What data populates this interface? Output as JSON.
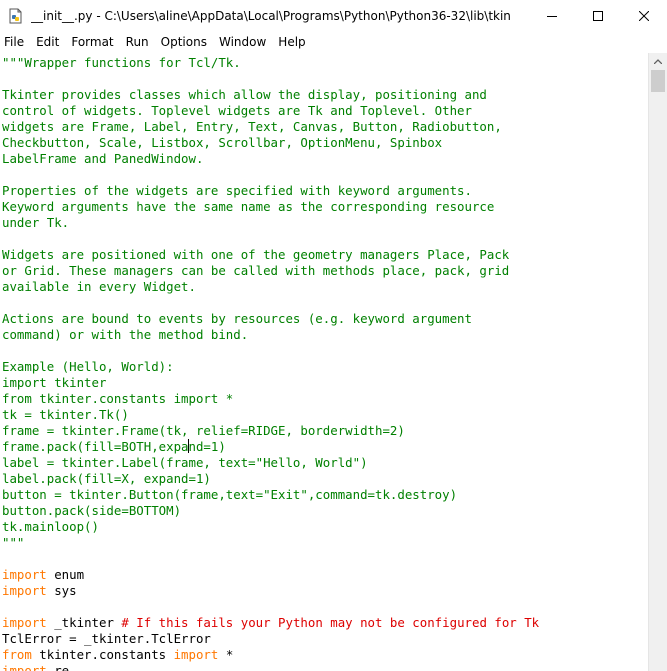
{
  "window": {
    "title": "__init__.py - C:\\Users\\aline\\AppData\\Local\\Programs\\Python\\Python36-32\\lib\\tkinter\\__init__....",
    "app_icon": "python-file-icon",
    "controls": {
      "minimize_icon": "minimize-icon",
      "maximize_icon": "maximize-icon",
      "close_icon": "close-icon"
    }
  },
  "menubar": {
    "items": [
      "File",
      "Edit",
      "Format",
      "Run",
      "Options",
      "Window",
      "Help"
    ]
  },
  "colors": {
    "string": "#008000",
    "keyword": "#ff7700",
    "comment": "#dd0000",
    "default": "#000000"
  },
  "editor": {
    "lines": [
      [
        {
          "t": "\"\"\"Wrapper functions for Tcl/Tk.",
          "c": "str"
        }
      ],
      [
        {
          "t": "",
          "c": "str"
        }
      ],
      [
        {
          "t": "Tkinter provides classes which allow the display, positioning and",
          "c": "str"
        }
      ],
      [
        {
          "t": "control of widgets. Toplevel widgets are Tk and Toplevel. Other",
          "c": "str"
        }
      ],
      [
        {
          "t": "widgets are Frame, Label, Entry, Text, Canvas, Button, Radiobutton,",
          "c": "str"
        }
      ],
      [
        {
          "t": "Checkbutton, Scale, Listbox, Scrollbar, OptionMenu, Spinbox",
          "c": "str"
        }
      ],
      [
        {
          "t": "LabelFrame and PanedWindow.",
          "c": "str"
        }
      ],
      [
        {
          "t": "",
          "c": "str"
        }
      ],
      [
        {
          "t": "Properties of the widgets are specified with keyword arguments.",
          "c": "str"
        }
      ],
      [
        {
          "t": "Keyword arguments have the same name as the corresponding resource",
          "c": "str"
        }
      ],
      [
        {
          "t": "under Tk.",
          "c": "str"
        }
      ],
      [
        {
          "t": "",
          "c": "str"
        }
      ],
      [
        {
          "t": "Widgets are positioned with one of the geometry managers Place, Pack",
          "c": "str"
        }
      ],
      [
        {
          "t": "or Grid. These managers can be called with methods place, pack, grid",
          "c": "str"
        }
      ],
      [
        {
          "t": "available in every Widget.",
          "c": "str"
        }
      ],
      [
        {
          "t": "",
          "c": "str"
        }
      ],
      [
        {
          "t": "Actions are bound to events by resources (e.g. keyword argument",
          "c": "str"
        }
      ],
      [
        {
          "t": "command) or with the method bind.",
          "c": "str"
        }
      ],
      [
        {
          "t": "",
          "c": "str"
        }
      ],
      [
        {
          "t": "Example (Hello, World):",
          "c": "str"
        }
      ],
      [
        {
          "t": "import tkinter",
          "c": "str"
        }
      ],
      [
        {
          "t": "from tkinter.constants import *",
          "c": "str"
        }
      ],
      [
        {
          "t": "tk = tkinter.Tk()",
          "c": "str"
        }
      ],
      [
        {
          "t": "frame = tkinter.Frame(tk, relief=RIDGE, borderwidth=2)",
          "c": "str"
        }
      ],
      [
        {
          "t": "frame.pack(fill=BOTH,expa",
          "c": "str"
        },
        {
          "t": "|cursor|",
          "c": "cursor"
        },
        {
          "t": "nd=1)",
          "c": "str"
        }
      ],
      [
        {
          "t": "label = tkinter.Label(frame, text=\"Hello, World\")",
          "c": "str"
        }
      ],
      [
        {
          "t": "label.pack(fill=X, expand=1)",
          "c": "str"
        }
      ],
      [
        {
          "t": "button = tkinter.Button(frame,text=\"Exit\",command=tk.destroy)",
          "c": "str"
        }
      ],
      [
        {
          "t": "button.pack(side=BOTTOM)",
          "c": "str"
        }
      ],
      [
        {
          "t": "tk.mainloop()",
          "c": "str"
        }
      ],
      [
        {
          "t": "\"\"\"",
          "c": "str"
        }
      ],
      [
        {
          "t": "",
          "c": "def"
        }
      ],
      [
        {
          "t": "import",
          "c": "kw"
        },
        {
          "t": " enum",
          "c": "def"
        }
      ],
      [
        {
          "t": "import",
          "c": "kw"
        },
        {
          "t": " sys",
          "c": "def"
        }
      ],
      [
        {
          "t": "",
          "c": "def"
        }
      ],
      [
        {
          "t": "import",
          "c": "kw"
        },
        {
          "t": " _tkinter ",
          "c": "def"
        },
        {
          "t": "# If this fails your Python may not be configured for Tk",
          "c": "cmt"
        }
      ],
      [
        {
          "t": "TclError = _tkinter.TclError",
          "c": "def"
        }
      ],
      [
        {
          "t": "from",
          "c": "kw"
        },
        {
          "t": " tkinter.constants ",
          "c": "def"
        },
        {
          "t": "import",
          "c": "kw"
        },
        {
          "t": " *",
          "c": "def"
        }
      ],
      [
        {
          "t": "import",
          "c": "kw"
        },
        {
          "t": " re",
          "c": "def"
        }
      ]
    ]
  },
  "scrollbar": {
    "up_arrow_icon": "arrow-up-icon",
    "position": 0.0
  }
}
